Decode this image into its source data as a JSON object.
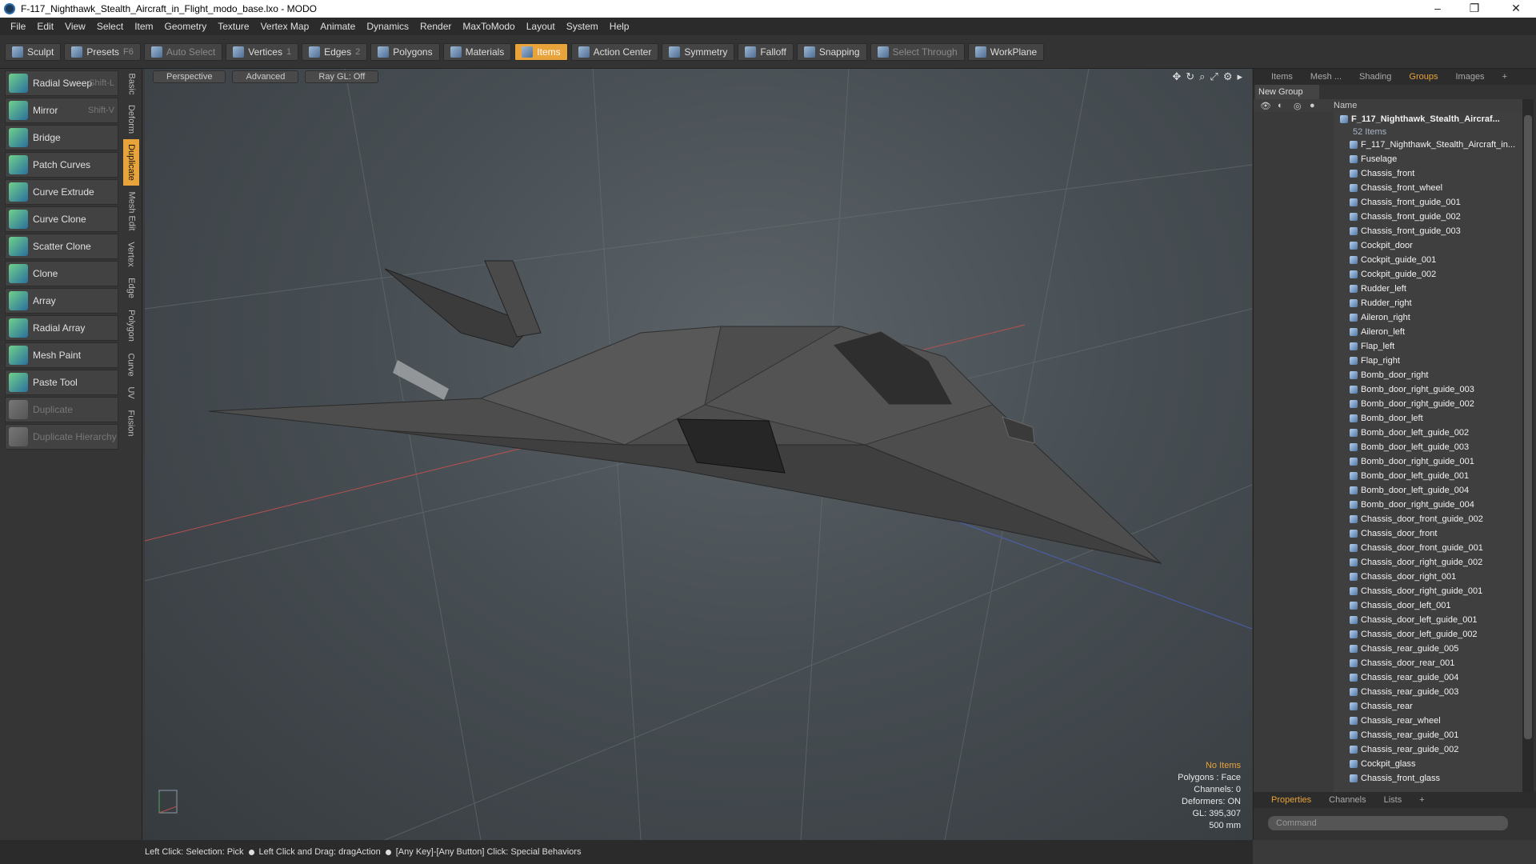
{
  "window": {
    "title": "F-117_Nighthawk_Stealth_Aircraft_in_Flight_modo_base.lxo - MODO",
    "minimize": "–",
    "maximize": "❐",
    "close": "✕"
  },
  "menu": [
    "File",
    "Edit",
    "View",
    "Select",
    "Item",
    "Geometry",
    "Texture",
    "Vertex Map",
    "Animate",
    "Dynamics",
    "Render",
    "MaxToModo",
    "Layout",
    "System",
    "Help"
  ],
  "toolbar": {
    "sculpt": "Sculpt",
    "presets": "Presets",
    "presets_key": "F6",
    "auto_select": "Auto Select",
    "vertices": "Vertices",
    "vertices_count": "1",
    "edges": "Edges",
    "edges_count": "2",
    "polygons": "Polygons",
    "materials": "Materials",
    "items": "Items",
    "action_center": "Action Center",
    "symmetry": "Symmetry",
    "falloff": "Falloff",
    "snapping": "Snapping",
    "select_through": "Select Through",
    "workplane": "WorkPlane"
  },
  "tools": [
    {
      "label": "Radial Sweep",
      "shortcut": "Shift-L"
    },
    {
      "label": "Mirror",
      "shortcut": "Shift-V"
    },
    {
      "label": "Bridge",
      "shortcut": ""
    },
    {
      "label": "Patch Curves",
      "shortcut": ""
    },
    {
      "label": "Curve Extrude",
      "shortcut": ""
    },
    {
      "label": "Curve Clone",
      "shortcut": ""
    },
    {
      "label": "Scatter Clone",
      "shortcut": ""
    },
    {
      "label": "Clone",
      "shortcut": ""
    },
    {
      "label": "Array",
      "shortcut": ""
    },
    {
      "label": "Radial Array",
      "shortcut": ""
    },
    {
      "label": "Mesh Paint",
      "shortcut": ""
    },
    {
      "label": "Paste Tool",
      "shortcut": ""
    },
    {
      "label": "Duplicate",
      "shortcut": ""
    },
    {
      "label": "Duplicate Hierarchy",
      "shortcut": ""
    }
  ],
  "vtabs": [
    "Basic",
    "Deform",
    "Duplicate",
    "Mesh Edit",
    "Vertex",
    "Edge",
    "Polygon",
    "Curve",
    "UV",
    "Fusion"
  ],
  "viewport": {
    "view": "Perspective",
    "shading": "Advanced",
    "raygl": "Ray GL: Off",
    "info": {
      "no_items": "No Items",
      "polygons": "Polygons : Face",
      "channels": "Channels: 0",
      "deformers": "Deformers: ON",
      "gl": "GL: 395,307",
      "scale": "500 mm"
    }
  },
  "right_panel": {
    "tabs": [
      "Items",
      "Mesh ...",
      "Shading",
      "Groups",
      "Images"
    ],
    "new_group": "New Group",
    "name_header": "Name",
    "root": "F_117_Nighthawk_Stealth_Aircraf...",
    "root_count": "52 Items",
    "items": [
      "F_117_Nighthawk_Stealth_Aircraft_in...",
      "Fuselage",
      "Chassis_front",
      "Chassis_front_wheel",
      "Chassis_front_guide_001",
      "Chassis_front_guide_002",
      "Chassis_front_guide_003",
      "Cockpit_door",
      "Cockpit_guide_001",
      "Cockpit_guide_002",
      "Rudder_left",
      "Rudder_right",
      "Aileron_right",
      "Aileron_left",
      "Flap_left",
      "Flap_right",
      "Bomb_door_right",
      "Bomb_door_right_guide_003",
      "Bomb_door_right_guide_002",
      "Bomb_door_left",
      "Bomb_door_left_guide_002",
      "Bomb_door_left_guide_003",
      "Bomb_door_right_guide_001",
      "Bomb_door_left_guide_001",
      "Bomb_door_left_guide_004",
      "Bomb_door_right_guide_004",
      "Chassis_door_front_guide_002",
      "Chassis_door_front",
      "Chassis_door_front_guide_001",
      "Chassis_door_right_guide_002",
      "Chassis_door_right_001",
      "Chassis_door_right_guide_001",
      "Chassis_door_left_001",
      "Chassis_door_left_guide_001",
      "Chassis_door_left_guide_002",
      "Chassis_rear_guide_005",
      "Chassis_door_rear_001",
      "Chassis_rear_guide_004",
      "Chassis_rear_guide_003",
      "Chassis_rear",
      "Chassis_rear_wheel",
      "Chassis_rear_guide_001",
      "Chassis_rear_guide_002",
      "Cockpit_glass",
      "Chassis_front_glass"
    ],
    "bottom_tabs": [
      "Properties",
      "Channels",
      "Lists"
    ],
    "command_placeholder": "Command"
  },
  "status": {
    "a": "Left Click: Selection: Pick",
    "b": "Left Click and Drag: dragAction",
    "c": "[Any Key]-[Any Button] Click: Special Behaviors"
  }
}
